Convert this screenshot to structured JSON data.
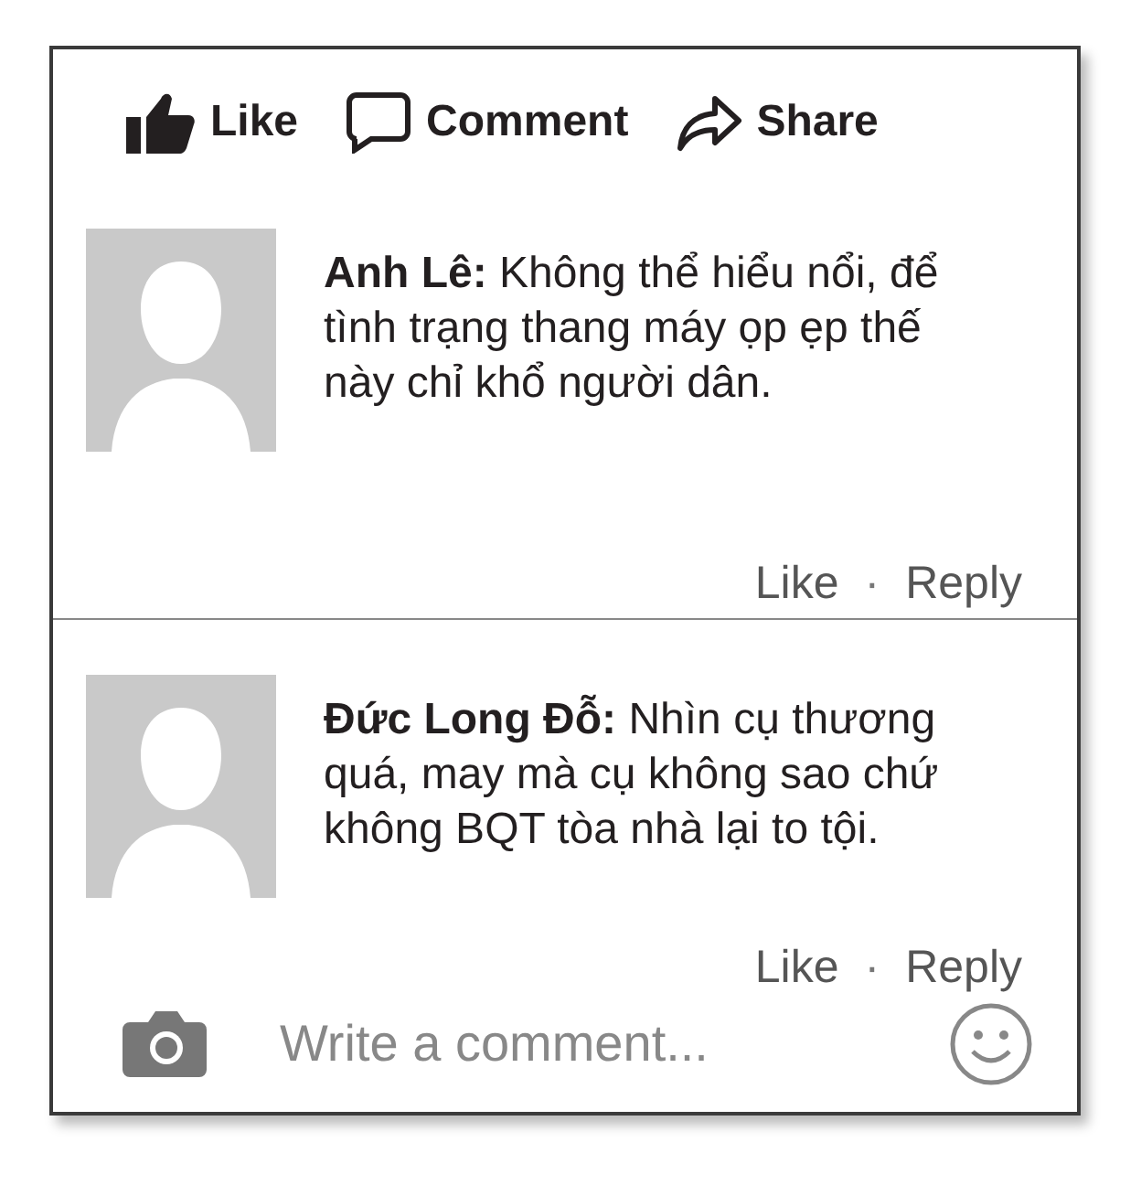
{
  "actions": [
    {
      "kind": "like",
      "label": "Like"
    },
    {
      "kind": "comment",
      "label": "Comment"
    },
    {
      "kind": "share",
      "label": "Share"
    }
  ],
  "comments": [
    {
      "text": "**Anh Lê:** Không thể hiểu nổi, để tình trạng thang máy ọp ẹp thế này chỉ khổ người dân.",
      "like": "Like",
      "separator": "·",
      "reply": "Reply"
    },
    {
      "text": "**Đức Long Đỗ:** Nhìn cụ thương quá, may mà cụ không sao chứ không BQT tòa nhà lại to tội.",
      "like": "Like",
      "separator": "·",
      "reply": "Reply"
    }
  ],
  "composer": {
    "placeholder": "Write a comment..."
  }
}
